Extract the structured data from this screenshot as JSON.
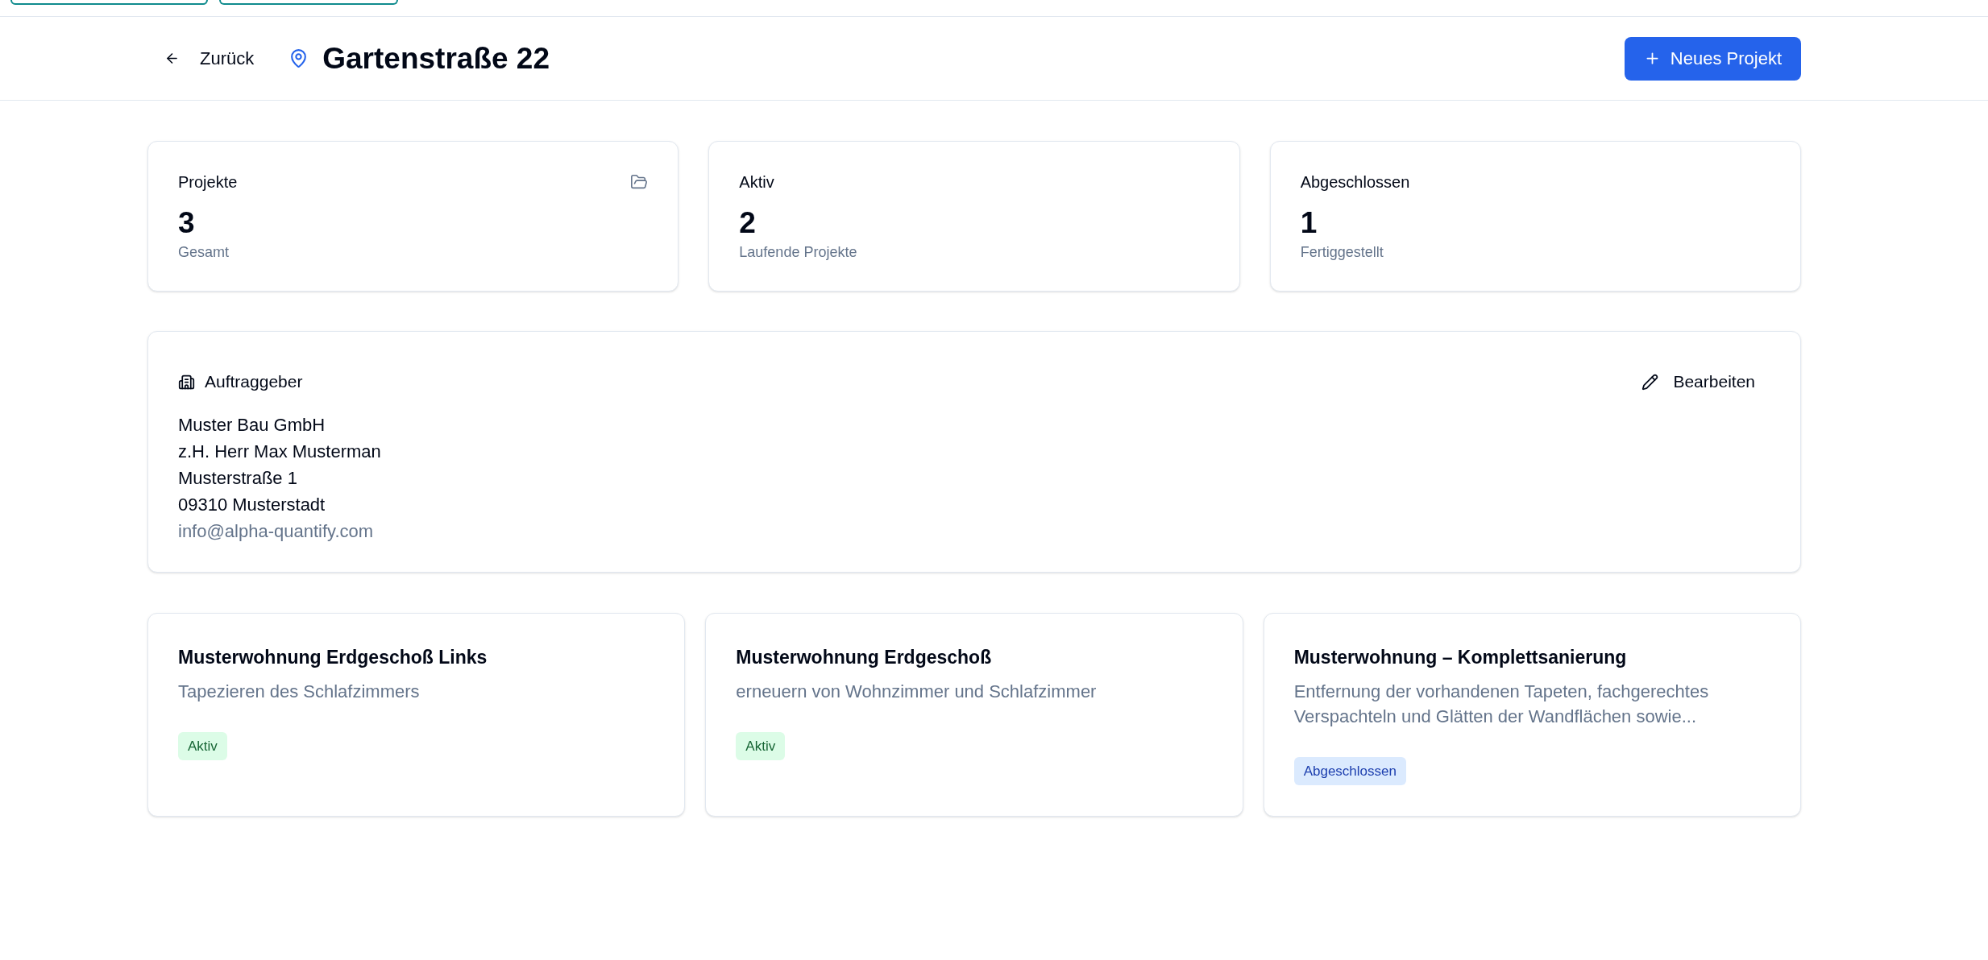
{
  "header": {
    "back_label": "Zurück",
    "title": "Gartenstraße 22",
    "new_button": "Neues Projekt"
  },
  "stats": [
    {
      "kind": "total",
      "label": "Projekte",
      "value": "3",
      "caption": "Gesamt"
    },
    {
      "kind": "active",
      "label": "Aktiv",
      "value": "2",
      "caption": "Laufende Projekte"
    },
    {
      "kind": "done",
      "label": "Abgeschlossen",
      "value": "1",
      "caption": "Fertiggestellt"
    }
  ],
  "client": {
    "heading": "Auftraggeber",
    "edit_button": "Bearbeiten",
    "company": "Muster Bau GmbH",
    "lines": [
      "z.H. Herr Max Musterman",
      "Musterstraße 1",
      "09310 Musterstadt"
    ],
    "email": "info@alpha-quantify.com"
  },
  "projects": [
    {
      "title": "Musterwohnung Erdgeschoß Links",
      "description": "Tapezieren des Schlafzimmers",
      "status": "Aktiv",
      "kind": "active"
    },
    {
      "title": "Musterwohnung Erdgeschoß",
      "description": "erneuern von Wohnzimmer und Schlafzimmer",
      "status": "Aktiv",
      "kind": "active"
    },
    {
      "title": "Musterwohnung – Komplettsanierung",
      "description": "Entfernung der vorhandenen Tapeten, fachgerechtes Verspachteln und Glätten der Wandflächen sowie...",
      "status": "Abgeschlossen",
      "kind": "done"
    }
  ]
}
